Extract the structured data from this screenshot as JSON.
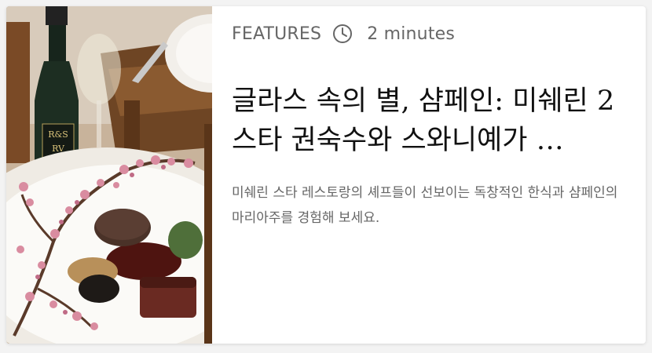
{
  "card": {
    "category": "FEATURES",
    "duration": "2 minutes",
    "title": "글라스 속의 별, 샴페인: 미쉐린 2 스타 권숙수와 스와니예가 …",
    "description": "미쉐린 스타 레스토랑의 셰프들이 선보이는 독창적인 한식과 샴페인의 마리아주를 경험해 보세요.",
    "image": {
      "bottle_label_line1": "R&S",
      "bottle_label_line2": "RV"
    },
    "icons": {
      "duration": "clock-icon"
    }
  }
}
